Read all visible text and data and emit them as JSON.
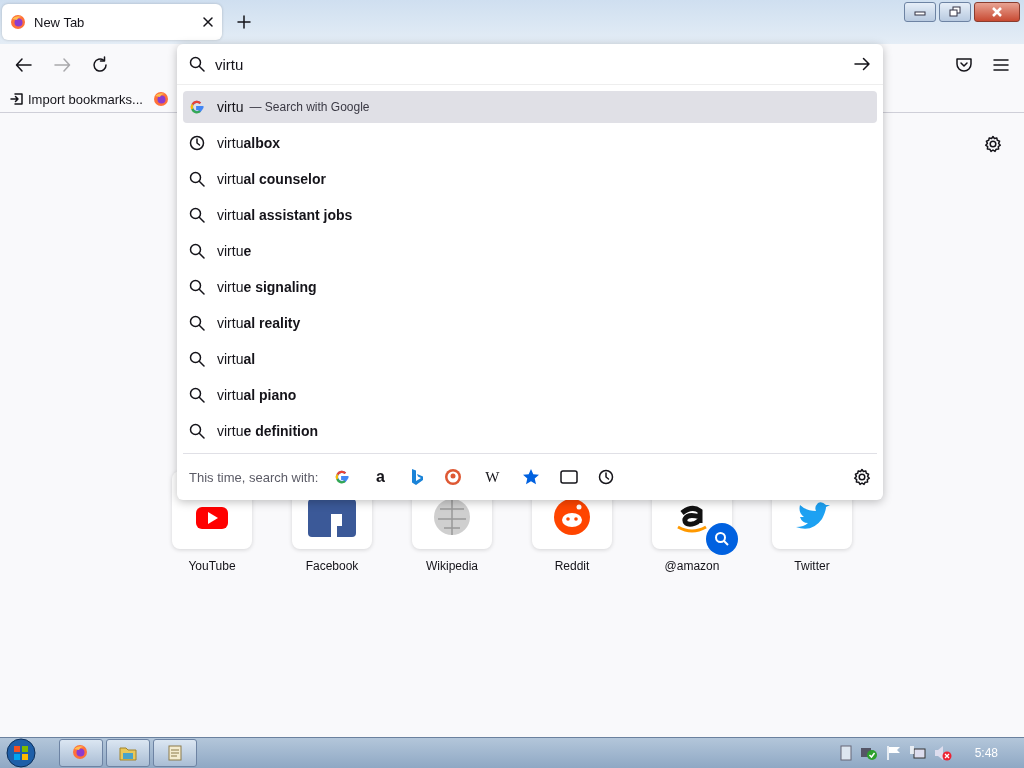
{
  "tabs": [
    {
      "title": "New Tab",
      "selected": true
    }
  ],
  "nav_buttons": [
    {
      "kind": "back",
      "disabled": false
    },
    {
      "kind": "forward",
      "disabled": true
    },
    {
      "kind": "reload",
      "disabled": false
    }
  ],
  "bookmarks": [
    {
      "kind": "import",
      "label": "Import bookmarks..."
    },
    {
      "kind": "firefox"
    }
  ],
  "url_panel": {
    "value": "virtu",
    "suggestions": [
      {
        "kind": "engine",
        "text": "virtu",
        "note": "— Search with Google",
        "selected": true
      },
      {
        "kind": "history",
        "text": "virtu**albox**",
        "selected": false
      },
      {
        "kind": "search",
        "text": "virtu**al counselor**",
        "selected": false
      },
      {
        "kind": "search",
        "text": "virtu**al assistant jobs**",
        "selected": false
      },
      {
        "kind": "search",
        "text": "virtu**e**",
        "selected": false
      },
      {
        "kind": "search",
        "text": "virtu**e signaling**",
        "selected": false
      },
      {
        "kind": "search",
        "text": "virtu**al reality**",
        "selected": false
      },
      {
        "kind": "search",
        "text": "virtu**al**",
        "selected": false
      },
      {
        "kind": "search",
        "text": "virtu**al piano**",
        "selected": false
      },
      {
        "kind": "search",
        "text": "virtu**e definition**",
        "selected": false
      }
    ],
    "search_with": {
      "label": "This time, search with:",
      "engines": [
        {
          "kind": "google"
        },
        {
          "kind": "amazon",
          "glyph": "a"
        },
        {
          "kind": "bing"
        },
        {
          "kind": "duckduckgo"
        },
        {
          "kind": "wikipedia",
          "glyph": "W"
        },
        {
          "kind": "bookmarks"
        },
        {
          "kind": "tabs"
        },
        {
          "kind": "history"
        }
      ]
    }
  },
  "shortcuts": [
    {
      "kind": "youtube",
      "label": "YouTube",
      "search_badge": false
    },
    {
      "kind": "facebook",
      "label": "Facebook",
      "search_badge": false
    },
    {
      "kind": "wikipedia",
      "label": "Wikipedia",
      "search_badge": false
    },
    {
      "kind": "reddit",
      "label": "Reddit",
      "search_badge": false
    },
    {
      "kind": "amazon",
      "label": "@amazon",
      "search_badge": true
    },
    {
      "kind": "twitter",
      "label": "Twitter",
      "search_badge": false
    }
  ],
  "taskbar": {
    "apps": [
      {
        "kind": "firefox"
      },
      {
        "kind": "explorer"
      },
      {
        "kind": "notepad"
      }
    ],
    "clock": "5:48"
  }
}
